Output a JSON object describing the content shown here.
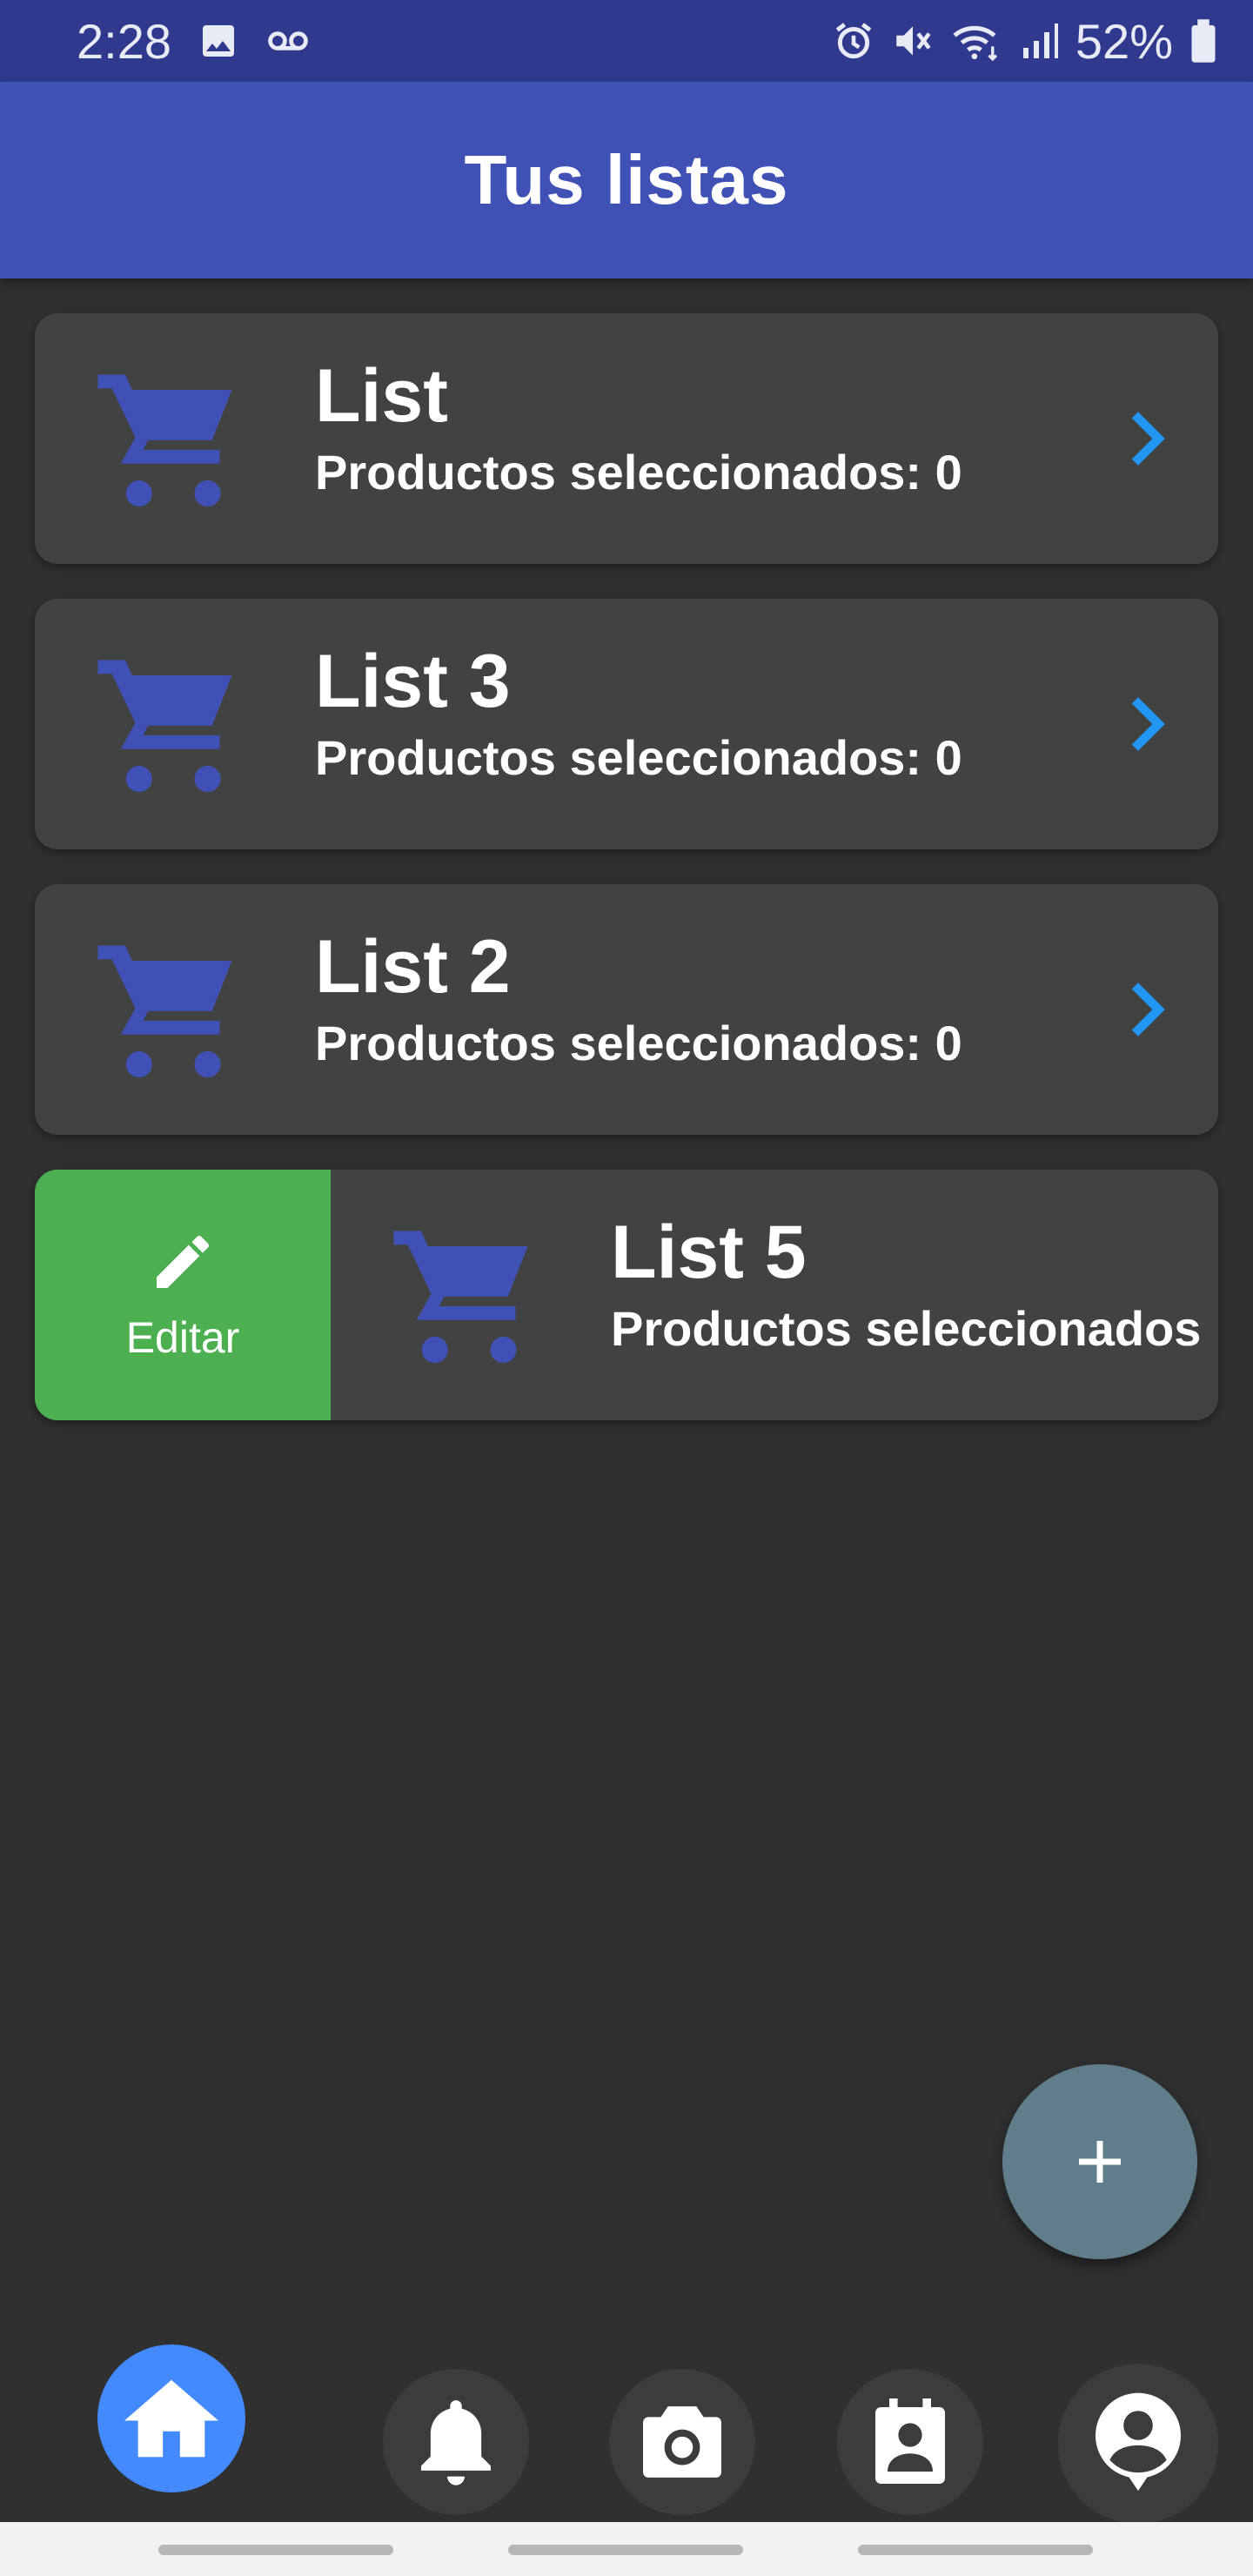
{
  "status_bar": {
    "time": "2:28",
    "battery": "52%",
    "icons": [
      "image-icon",
      "voicemail-icon",
      "alarm-icon",
      "mute-icon",
      "wifi-icon",
      "signal-icon",
      "battery-icon"
    ]
  },
  "app_bar": {
    "title": "Tus listas"
  },
  "lists": [
    {
      "title": "List",
      "subtitle": "Productos seleccionados: 0"
    },
    {
      "title": "List 3",
      "subtitle": "Productos seleccionados: 0"
    },
    {
      "title": "List 2",
      "subtitle": "Productos seleccionados: 0"
    },
    {
      "title": "List 5",
      "subtitle": "Productos seleccionados"
    }
  ],
  "swipe_action": {
    "label": "Editar",
    "icon": "pencil-icon",
    "color": "#4caf50"
  },
  "fab": {
    "icon": "plus-icon",
    "color": "#607d8b"
  },
  "bottom_nav": {
    "items": [
      "home-icon",
      "bell-icon",
      "camera-icon",
      "contacts-icon",
      "account-icon"
    ],
    "active": "home-icon",
    "active_color": "#448aff"
  },
  "colors": {
    "app_bar": "#3f51b5",
    "status_bar": "#2f3a8f",
    "background": "#303030",
    "card": "#424242",
    "cart_icon": "#3f51b5",
    "chevron": "#2196f3"
  }
}
